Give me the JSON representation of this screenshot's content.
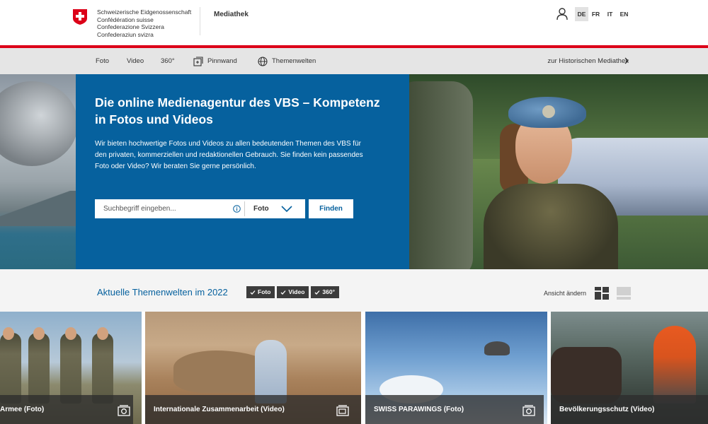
{
  "header": {
    "org_lines": [
      "Schweizerische Eidgenossenschaft",
      "Confédération suisse",
      "Confederazione Svizzera",
      "Confederaziun svizra"
    ],
    "section": "Mediathek",
    "languages": [
      "DE",
      "FR",
      "IT",
      "EN"
    ],
    "active_language": "DE"
  },
  "nav": {
    "items": [
      "Foto",
      "Video",
      "360°",
      "Pinnwand",
      "Themenwelten"
    ],
    "historic_link": "zur Historischen Mediathek"
  },
  "hero": {
    "title": "Die online Medienagentur des VBS – Kompetenz in Fotos und Videos",
    "text": "Wir bieten hochwertige Fotos und Videos zu allen bedeutenden Themen des VBS für den privaten, kommerziellen und redaktionellen Gebrauch. Sie finden kein passendes Foto oder Video? Wir beraten Sie gerne persönlich.",
    "search_placeholder": "Suchbegriff eingeben...",
    "search_value": "",
    "select_value": "Foto",
    "find_button": "Finden"
  },
  "themen": {
    "title": "Aktuelle Themenwelten im 2022",
    "filters": [
      "Foto",
      "Video",
      "360°"
    ],
    "view_label": "Ansicht ändern"
  },
  "cards": [
    {
      "label": "Armee (Foto)"
    },
    {
      "label": "Internationale Zusammenarbeit (Video)"
    },
    {
      "label": "SWISS PARAWINGS (Foto)"
    },
    {
      "label": "Bevölkerungsschutz (Video)"
    }
  ],
  "colors": {
    "brand_red": "#dc0018",
    "brand_blue": "#06619e",
    "nav_bg": "#e5e5e5",
    "section_bg": "#f4f4f4"
  }
}
